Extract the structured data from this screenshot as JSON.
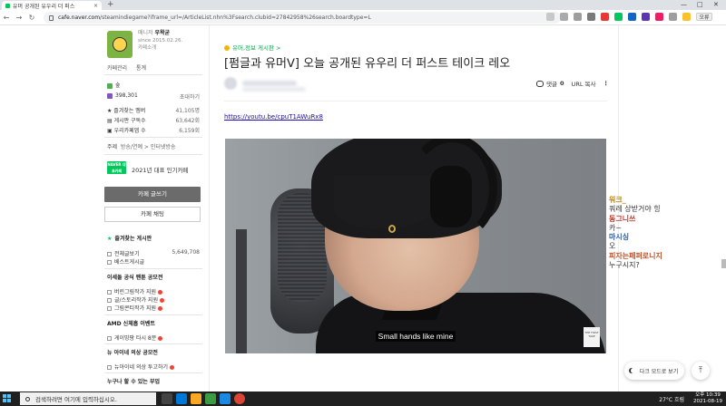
{
  "browser": {
    "tab_title": "유머 공개된 유우리 더 퍼스",
    "tab_close": "×",
    "new_tab": "+",
    "url_host": "cafe.naver.com",
    "url_path": "/steamindiegame?iframe_url=/ArticleList.nhn%3Fsearch.clubid=27842958%26search.boardtype=L",
    "window_controls": [
      "—",
      "□",
      "✕"
    ],
    "nav": [
      "←",
      "→",
      "↻"
    ],
    "profile_badge": "오류"
  },
  "sidebar": {
    "manager_label": "매니저",
    "manager_name": "우왁굳",
    "since": "since 2015.02.26.",
    "cafe_intro": "카페소개",
    "cafe_manage": "카페관리",
    "stats_link": "통계",
    "grade_label": "숲",
    "members_count": "398,301",
    "invite_label": "초대하기",
    "stats": [
      {
        "label": "즐겨찾는 멤버",
        "value": "41,105명"
      },
      {
        "label": "게시판 구독수",
        "value": "63,642회"
      },
      {
        "label": "우리카페앱 수",
        "value": "6,159회"
      }
    ],
    "theme_label": "주제",
    "theme_value": "방송/연예 > 인터넷방송",
    "naver_badge": "NAVER 대표카페",
    "popular_label": "2021년 대표 인기카페",
    "write_button": "카페 글쓰기",
    "chat_button": "카페 채팅",
    "fav_boards_head": "즐겨찾는 게시판",
    "menu": [
      {
        "label": "전체글보기",
        "count": "5,649,708"
      },
      {
        "label": "베스트게시글",
        "count": ""
      },
      {
        "label": "이세돌 공식 팬툰 공모전",
        "count": "",
        "head": true
      },
      {
        "label": "버린그림작가 지원",
        "count": "",
        "new": true
      },
      {
        "label": "글/스토리작가 지원",
        "count": "",
        "new": true
      },
      {
        "label": "그림콘티작가 지원",
        "count": "",
        "new": true
      },
      {
        "label": "AMD 신체흡 이벤트",
        "count": "",
        "head": true
      },
      {
        "label": "게이밍팡 타시 8분",
        "count": "",
        "new": true
      },
      {
        "label": "뉴 아이네 의상 공모전",
        "count": "",
        "head": true
      },
      {
        "label": "뉴아이네 의상 투고하기",
        "count": "",
        "new": true
      },
      {
        "label": "누구나 할 수 있는 부업",
        "count": "",
        "head": true
      }
    ]
  },
  "article": {
    "board": "유머,정보 게시판 >",
    "title": "[펌글과 유머ᐯ] 오늘 공개된 유우리 더 퍼스트 테이크 레오",
    "comment_label": "댓글",
    "comment_count": "0",
    "url_copy": "URL 복사",
    "more": "⋮",
    "youtube_link": "https://youtu.be/cpuT1AWuRx8",
    "video_subtitle": "Small hands like mine",
    "video_watermark": "THE FIRST TAKE"
  },
  "chat": [
    {
      "name": "워크_",
      "msg": "쿼레 상받거야 힝",
      "color": "#b8860b"
    },
    {
      "name": "동그니쓰",
      "msg": "카~",
      "color": "#c0392b"
    },
    {
      "name": "마시싱",
      "msg": "오",
      "color": "#2e5fa8"
    },
    {
      "name": "피자는페퍼로니지",
      "msg": "누구시지?",
      "color": "#c0542b"
    }
  ],
  "floating": {
    "dark_mode": "다크 모드로 보기",
    "top": "⤒"
  },
  "taskbar": {
    "search_placeholder": "검색하려면 여기에 입력하십시오.",
    "weather": "27°C 흐림",
    "time": "오후 10:39",
    "date": "2021-08-19"
  },
  "colors": {
    "naver_green": "#03c75a",
    "link_blue": "#1a0dab",
    "write_button": "#6b6b6b"
  }
}
